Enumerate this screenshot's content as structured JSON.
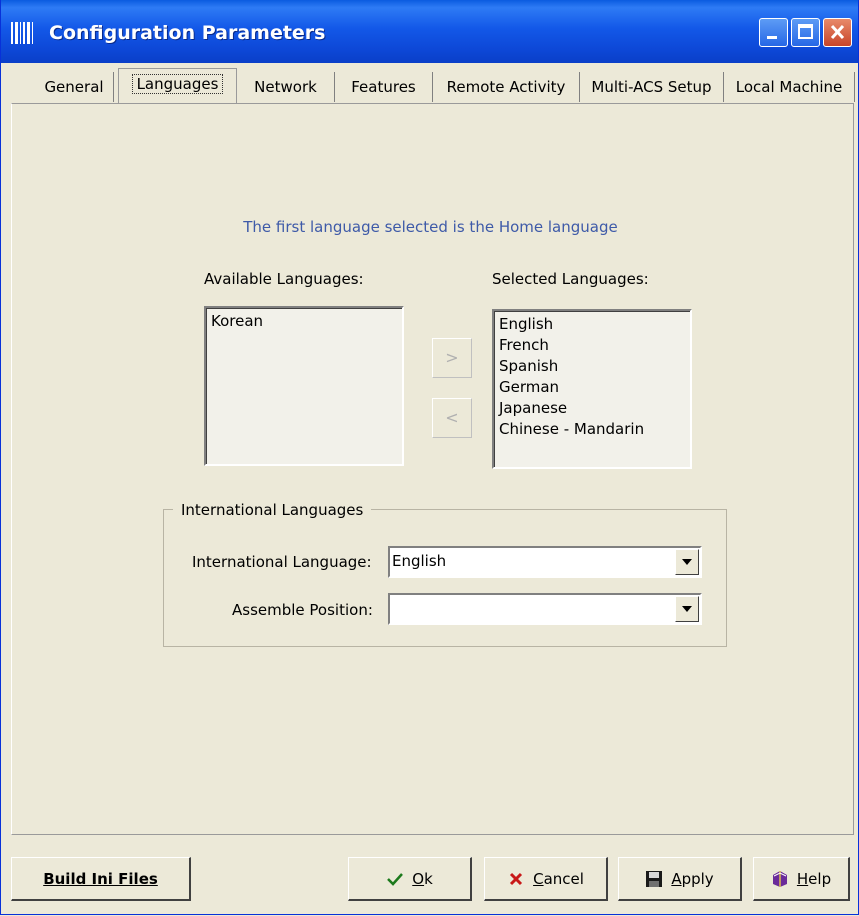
{
  "window": {
    "title": "Configuration Parameters"
  },
  "tabs": [
    "General",
    "Languages",
    "Network",
    "Features",
    "Remote Activity",
    "Multi-ACS Setup",
    "Local Machine"
  ],
  "active_tab": "Languages",
  "languages": {
    "hint": "The first language selected is the Home language",
    "available_label": "Available Languages:",
    "selected_label": "Selected Languages:",
    "available": [
      "Korean"
    ],
    "selected": [
      "English",
      "French",
      "Spanish",
      "German",
      "Japanese",
      "Chinese - Mandarin"
    ],
    "add_label": ">",
    "remove_label": "<"
  },
  "international": {
    "group_title": "International Languages",
    "language_label": "International Language:",
    "language_value": "English",
    "assemble_label": "Assemble Position:",
    "assemble_value": ""
  },
  "footer": {
    "build": "Build Ini Files",
    "ok_mnemonic": "O",
    "ok_rest": "k",
    "cancel_mnemonic": "C",
    "cancel_rest": "ancel",
    "apply_mnemonic": "A",
    "apply_rest": "pply",
    "help_mnemonic": "H",
    "help_rest": "elp"
  },
  "icons": {
    "app": "barcode-icon",
    "minimize": "minimize-icon",
    "maximize": "maximize-icon",
    "close": "close-icon",
    "ok": "checkmark-icon",
    "cancel": "x-icon",
    "apply": "floppy-disk-icon",
    "help": "help-book-icon"
  }
}
